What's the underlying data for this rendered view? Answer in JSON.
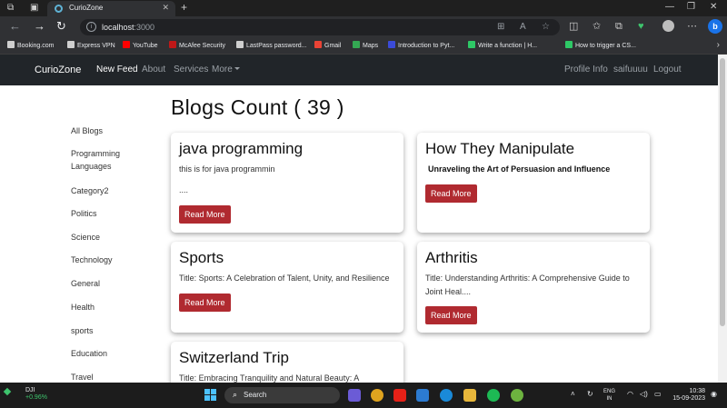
{
  "browser": {
    "tab_title": "CurioZone",
    "url_host": "localhost",
    "url_port": ":3000",
    "bookmarks": [
      {
        "label": "Booking.com",
        "color": "#cfcfcf"
      },
      {
        "label": "Express VPN",
        "color": "#cfcfcf"
      },
      {
        "label": "YouTube",
        "color": "#ff0000"
      },
      {
        "label": "McAfee Security",
        "color": "#c01818"
      },
      {
        "label": "LastPass password...",
        "color": "#cfcfcf"
      },
      {
        "label": "Gmail",
        "color": "#ea4335"
      },
      {
        "label": "Maps",
        "color": "#34a853"
      },
      {
        "label": "Introduction to Pyt...",
        "color": "#3b4bd8"
      },
      {
        "label": "Write a function | H...",
        "color": "#2ec866"
      },
      {
        "label": "How to trigger a CS...",
        "color": "#2ec866"
      }
    ]
  },
  "navbar": {
    "brand": "CurioZone",
    "links": [
      "New Feed",
      "About",
      "Services",
      "More"
    ],
    "right_links": [
      "Profile Info",
      "saifuuuu",
      "Logout"
    ]
  },
  "heading": "Blogs Count ( 39 )",
  "sidebar": [
    "All Blogs",
    "Programming Languages",
    "Category2",
    "Politics",
    "Science",
    "Technology",
    "General",
    "Health",
    "sports",
    "Education",
    "Travel"
  ],
  "cards": [
    {
      "title": "java programming",
      "desc": "this is for java programmin",
      "extra": "....",
      "button": "Read More"
    },
    {
      "title": "How They Manipulate",
      "desc": "Unraveling the Art of Persuasion and Influence",
      "button": "Read More"
    },
    {
      "title": "Sports",
      "desc": "Title: Sports: A Celebration of Talent, Unity, and Resilience",
      "button": "Read More"
    },
    {
      "title": "Arthritis",
      "desc": "Title: Understanding Arthritis: A Comprehensive Guide to Joint Heal....",
      "button": "Read More"
    },
    {
      "title": "Switzerland Trip",
      "desc": "Title: Embracing Tranquility and Natural Beauty: A"
    }
  ],
  "taskbar": {
    "stock_name": "DJI",
    "stock_change": "+0.96%",
    "search_label": "Search",
    "lang_top": "ENG",
    "lang_bottom": "IN",
    "time": "10:38",
    "date": "15-09-2023"
  },
  "colors": {
    "navbar_bg": "#212529",
    "button_bg": "#b02a30",
    "page_bg": "#ffffff"
  }
}
